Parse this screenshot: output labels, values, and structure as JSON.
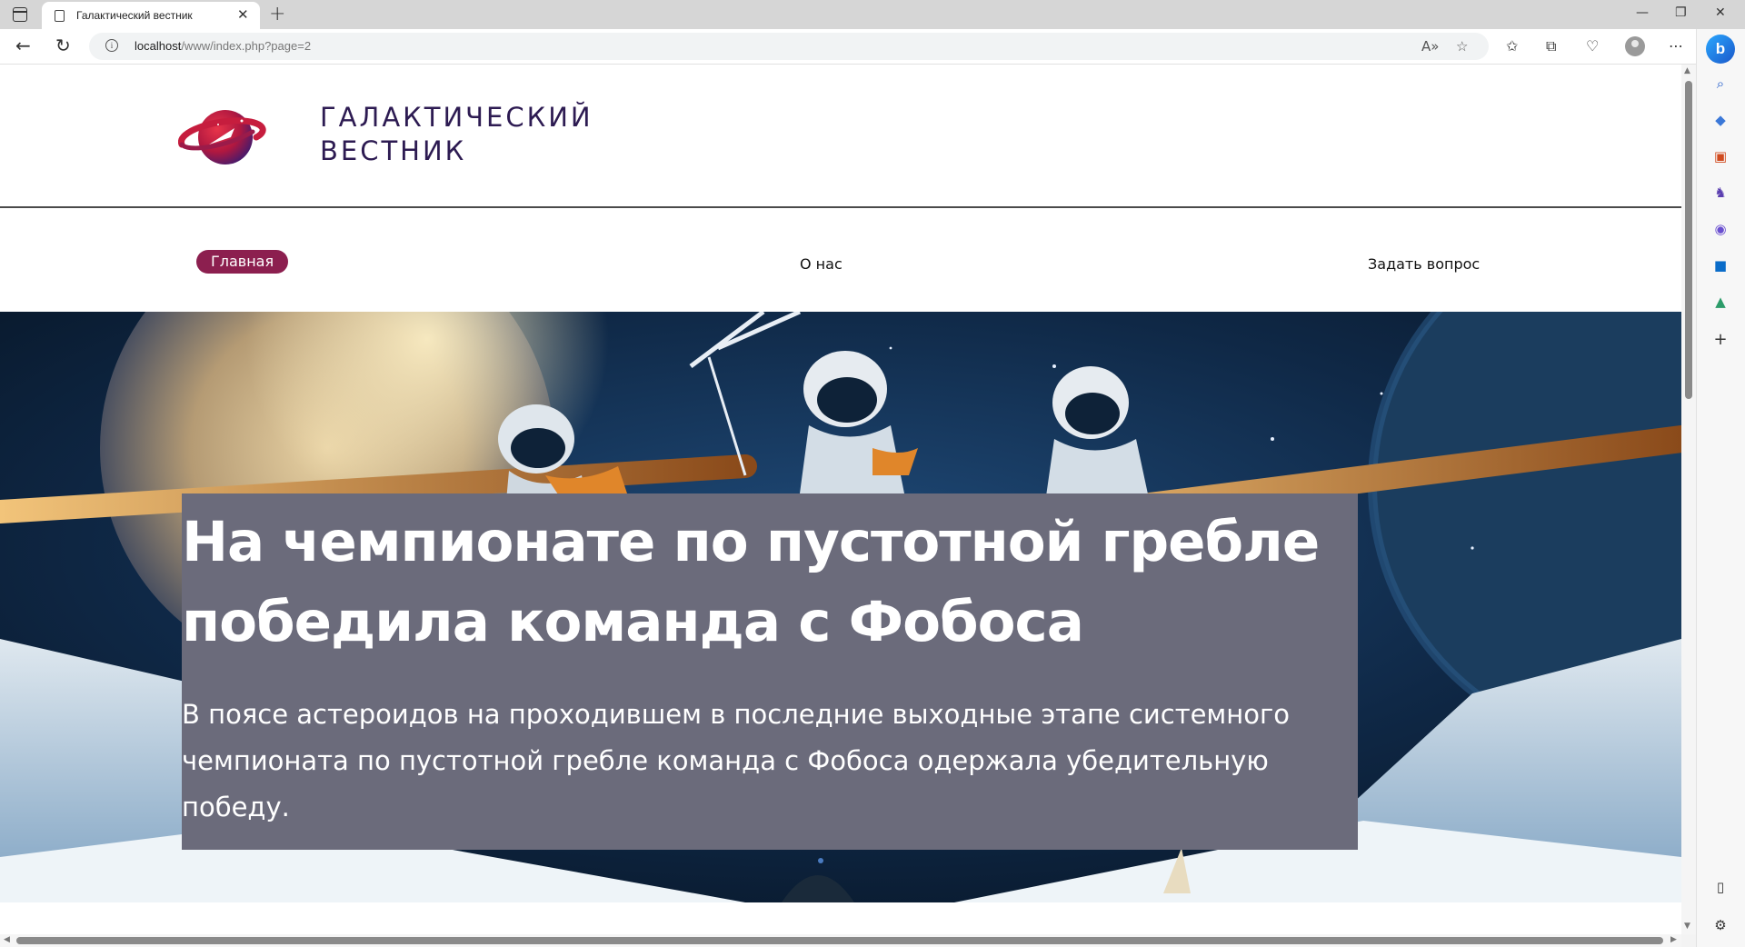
{
  "browser": {
    "tab_title": "Галактический вестник",
    "tab_close": "✕",
    "new_tab": "+",
    "url_host": "localhost",
    "url_path": "/www/index.php?page=2",
    "window_controls": {
      "minimize": "—",
      "restore": "❐",
      "close": "✕"
    }
  },
  "site": {
    "brand_line1": "Галактический",
    "brand_line2": "вестник",
    "nav": [
      {
        "label": "Главная"
      },
      {
        "label": "О нас"
      },
      {
        "label": "Задать вопрос"
      }
    ]
  },
  "hero": {
    "headline": "На чемпионате по пустотной гребле победила команда с Фобоса",
    "lead": "В поясе астероидов на проходившем в последние выходные этапе системного чемпионата по пустотной гребле команда с Фобоса одержала убедительную победу."
  },
  "colors": {
    "accent": "#8c1f4f",
    "brand_text": "#2d1b52",
    "caption_bg": "#6b6b7b"
  },
  "icons": [
    "back-icon",
    "refresh-icon",
    "info-icon",
    "read-aloud-icon",
    "favorite-icon",
    "favorites-icon",
    "collections-icon",
    "performance-icon",
    "profile-icon",
    "more-icon",
    "bing-icon",
    "search-icon",
    "shopping-icon",
    "tools-icon",
    "games-icon",
    "office-icon",
    "outlook-icon",
    "drop-icon",
    "add-icon",
    "split-screen-icon",
    "settings-icon"
  ]
}
